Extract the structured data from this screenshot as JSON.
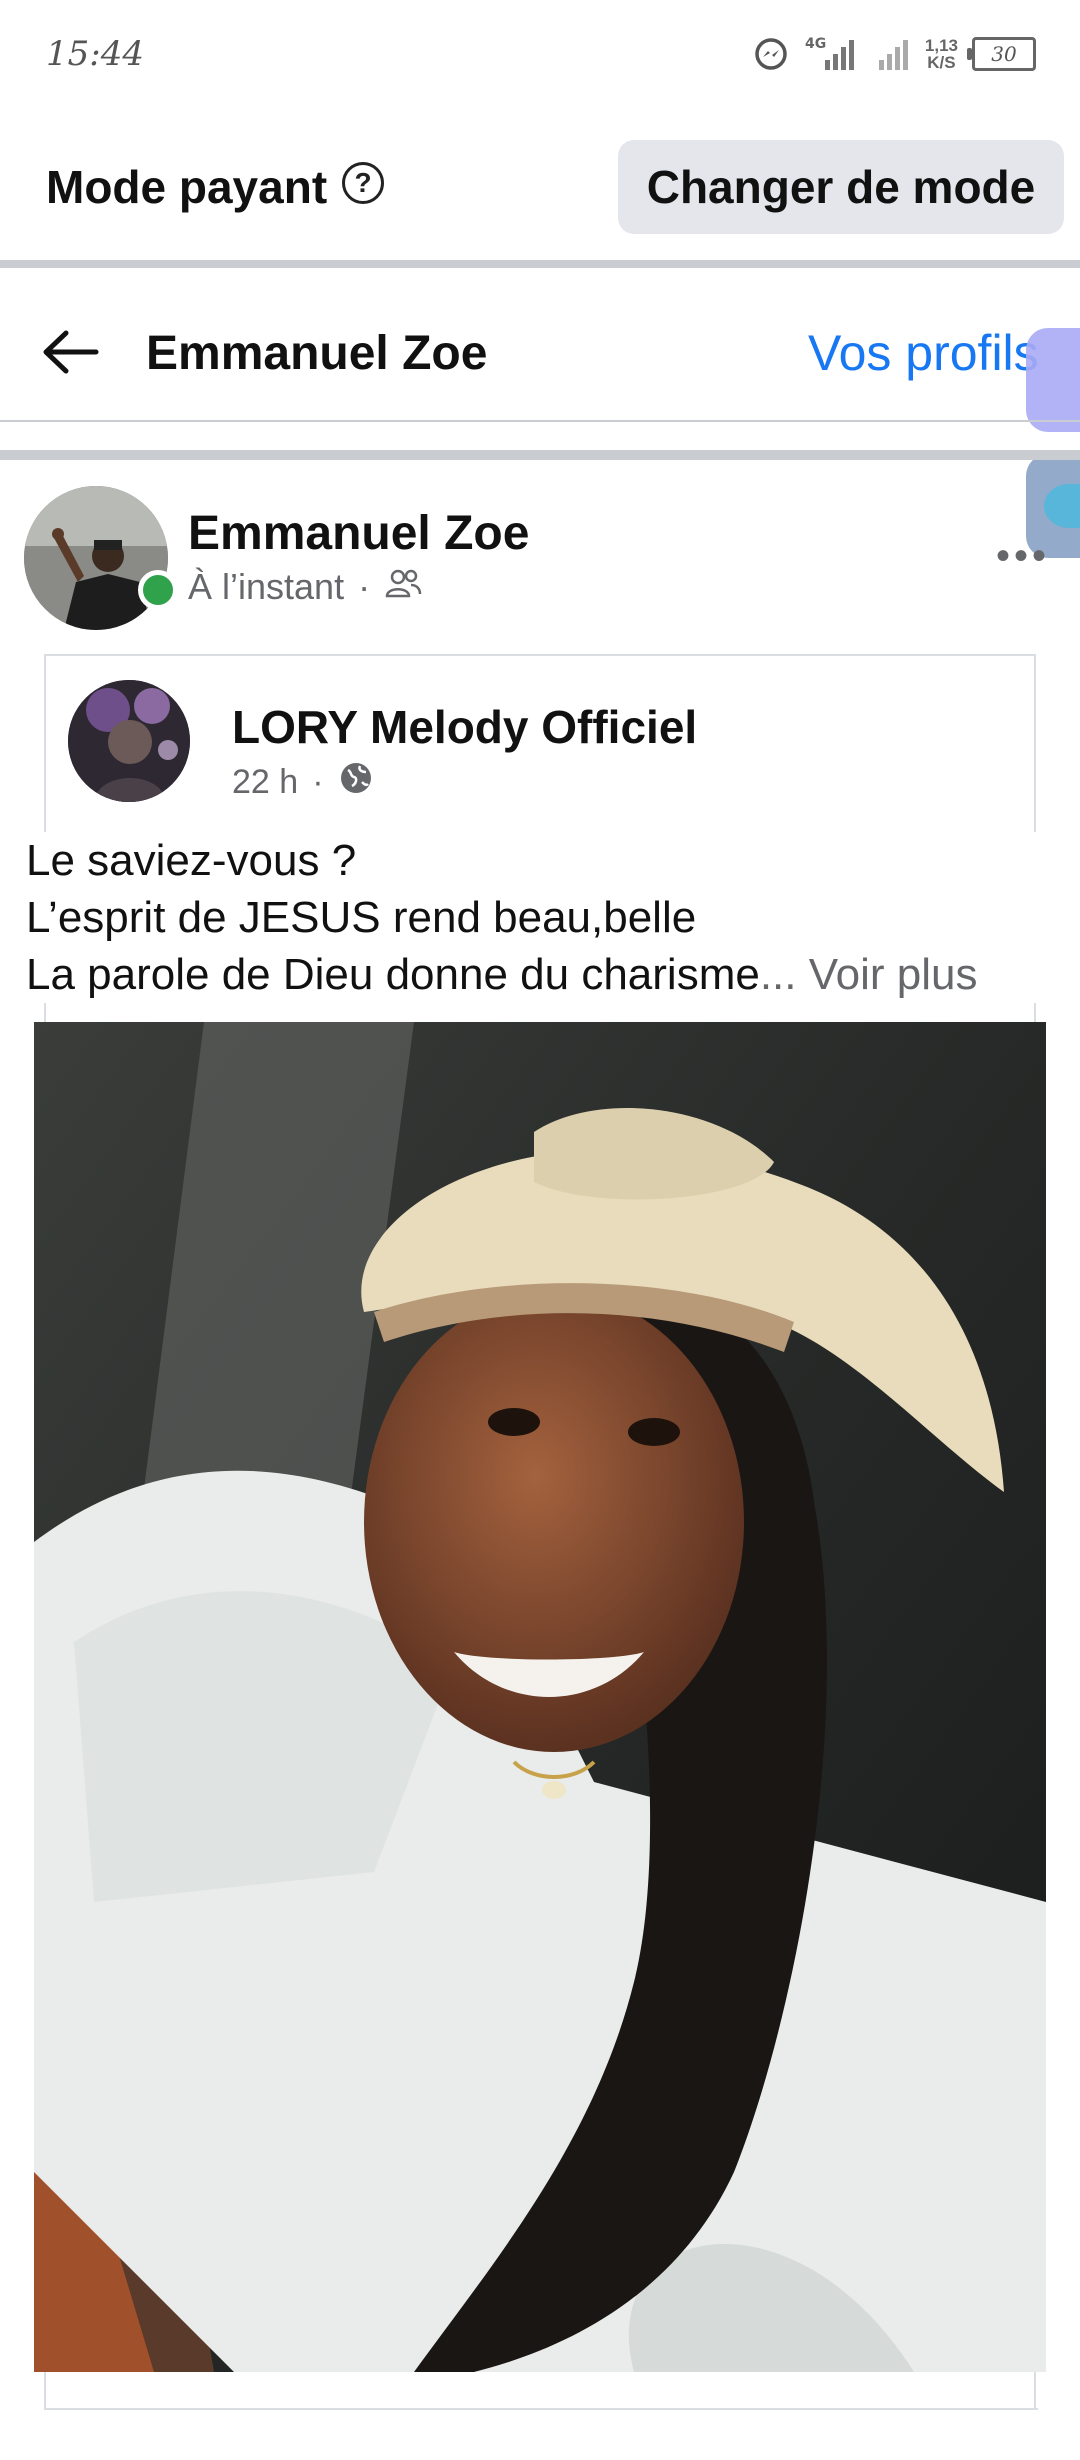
{
  "status_bar": {
    "time": "15:44",
    "network": "4G",
    "speed_top": "1,13",
    "speed_unit": "K/S",
    "battery": "30"
  },
  "mode_bar": {
    "title": "Mode payant",
    "help_icon": "?",
    "switch_button": "Changer de mode"
  },
  "header": {
    "title": "Emmanuel Zoe",
    "profiles_link": "Vos profils"
  },
  "post": {
    "author": "Emmanuel Zoe",
    "time": "À l’instant",
    "separator": "·",
    "more": "•••",
    "shared": {
      "page_name": "LORY Melody Officiel",
      "time": "22 h",
      "separator": "·",
      "text_line_1": "Le saviez-vous ?",
      "text_line_2": "L’esprit de JESUS rend beau,belle",
      "text_line_3": "La parole de Dieu donne du charisme",
      "ellipsis": "...",
      "see_more": "Voir plus"
    }
  },
  "colors": {
    "link": "#1877f2",
    "online": "#31a24c",
    "secondary_text": "#65676b"
  },
  "icons": [
    "back-arrow-icon",
    "help-icon",
    "friends-icon",
    "globe-icon",
    "messenger-icon",
    "more-icon"
  ]
}
